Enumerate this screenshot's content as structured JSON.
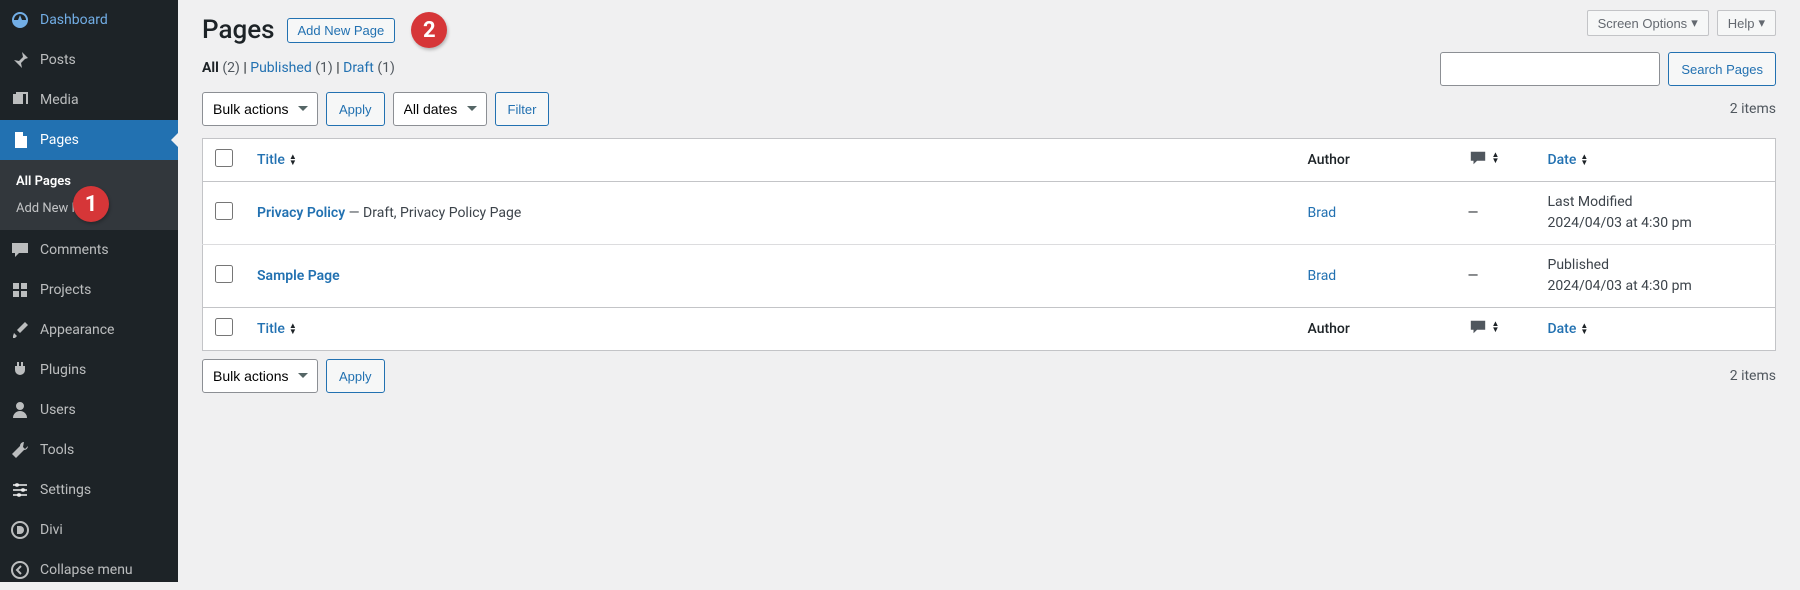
{
  "annot": {
    "one": "1",
    "two": "2"
  },
  "sidebar": {
    "items": [
      {
        "label": "Dashboard"
      },
      {
        "label": "Posts"
      },
      {
        "label": "Media"
      },
      {
        "label": "Pages"
      },
      {
        "label": "Comments"
      },
      {
        "label": "Projects"
      },
      {
        "label": "Appearance"
      },
      {
        "label": "Plugins"
      },
      {
        "label": "Users"
      },
      {
        "label": "Tools"
      },
      {
        "label": "Settings"
      },
      {
        "label": "Divi"
      },
      {
        "label": "Collapse menu"
      }
    ],
    "submenu": [
      {
        "label": "All Pages"
      },
      {
        "label": "Add New Page"
      }
    ]
  },
  "header": {
    "title": "Pages",
    "add_new": "Add New Page",
    "screen_options": "Screen Options",
    "help": "Help"
  },
  "filters": {
    "all_label": "All",
    "all_count": "(2)",
    "published_label": "Published",
    "published_count": "(1)",
    "draft_label": "Draft",
    "draft_count": "(1)",
    "sep": "  |  "
  },
  "actions": {
    "bulk": "Bulk actions",
    "apply": "Apply",
    "all_dates": "All dates",
    "filter": "Filter",
    "search_btn": "Search Pages"
  },
  "items_count": "2 items",
  "columns": {
    "title": "Title",
    "author": "Author",
    "date": "Date"
  },
  "rows": [
    {
      "title": "Privacy Policy",
      "meta": " — Draft, Privacy Policy Page",
      "author": "Brad",
      "comments": "—",
      "date_status": "Last Modified",
      "date_value": "2024/04/03 at 4:30 pm"
    },
    {
      "title": "Sample Page",
      "meta": "",
      "author": "Brad",
      "comments": "—",
      "date_status": "Published",
      "date_value": "2024/04/03 at 4:30 pm"
    }
  ]
}
